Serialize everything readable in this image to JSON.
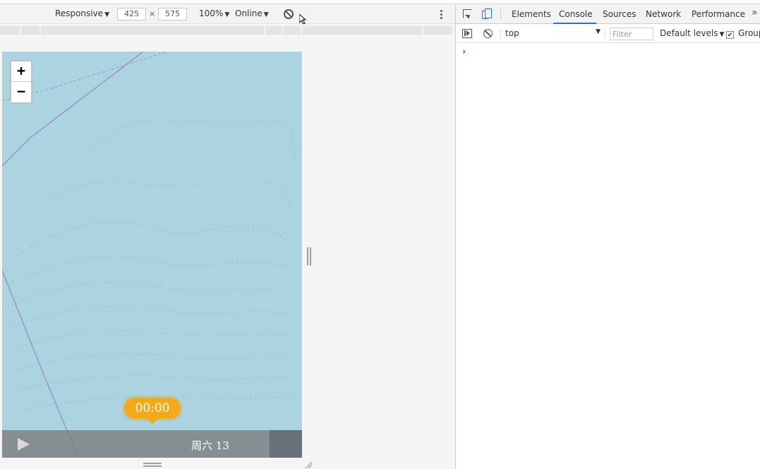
{
  "device_toolbar": {
    "device": "Responsive",
    "width": "425",
    "height_value": "575",
    "dim_separator": "×",
    "zoom": "100%",
    "throttle": "Online"
  },
  "map": {
    "zoom_in": "+",
    "zoom_out": "−",
    "time": "00:00",
    "day": "周六 13",
    "water_color": "#abd3e0",
    "bubble_color": "#f2a91a"
  },
  "devtools": {
    "tabs": [
      "Elements",
      "Console",
      "Sources",
      "Network",
      "Performance"
    ],
    "active_tab": "Console",
    "overflow": "»",
    "console": {
      "context": "top",
      "filter_placeholder": "Filter",
      "levels": "Default levels",
      "group_label": "Group",
      "prompt": "›"
    }
  },
  "icons": [
    "inspect-icon",
    "device-toggle-icon",
    "sidebar-icon",
    "clear-console-icon",
    "rotate-icon",
    "kebab-menu-icon",
    "play-icon"
  ]
}
